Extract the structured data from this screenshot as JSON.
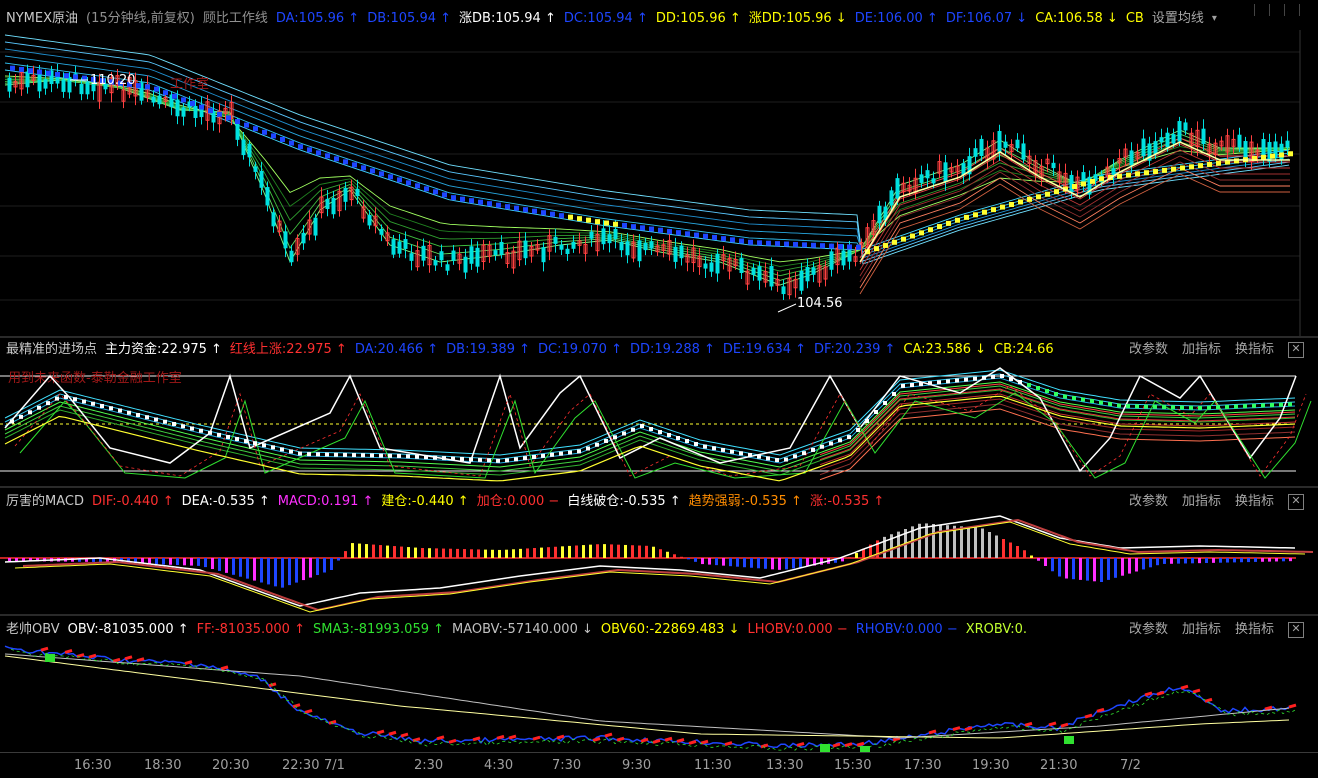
{
  "colors": {
    "red": "#ff3030",
    "white": "#ffffff",
    "yellow": "#ffff00",
    "blue": "#1e3cff",
    "cyan": "#00e5ff",
    "green": "#30e030",
    "magenta": "#ff30ff",
    "orange": "#ff8c00",
    "gray": "#c0c0c0"
  },
  "main": {
    "title": "NYMEX原油",
    "subtitle": "(15分钟线,前复权)",
    "studio": "顾比工作线",
    "indicators": [
      {
        "text": "DA:105.96 ↑",
        "color": "#1e46ff"
      },
      {
        "text": "DB:105.94 ↑",
        "color": "#1e46ff"
      },
      {
        "text": "涨DB:105.94 ↑",
        "color": "#ffffff"
      },
      {
        "text": "DC:105.94 ↑",
        "color": "#1e46ff"
      },
      {
        "text": "DD:105.96 ↑",
        "color": "#ffff00"
      },
      {
        "text": "涨DD:105.96 ↓",
        "color": "#ffff00"
      },
      {
        "text": "DE:106.00 ↑",
        "color": "#1e46ff"
      },
      {
        "text": "DF:106.07 ↓",
        "color": "#1e46ff"
      },
      {
        "text": "CA:106.58 ↓",
        "color": "#ffff00"
      },
      {
        "text": "CB",
        "color": "#ffff00"
      }
    ],
    "settings_label": "设置均线",
    "high_label": "110.20",
    "low_label": "104.56",
    "watermark": "工作室"
  },
  "entry": {
    "title": "最精准的进场点",
    "indicators": [
      {
        "text": "主力资金:22.975 ↑",
        "color": "#ffffff"
      },
      {
        "text": "红线上涨:22.975 ↑",
        "color": "#ff3030"
      },
      {
        "text": "DA:20.466 ↑",
        "color": "#1e46ff"
      },
      {
        "text": "DB:19.389 ↑",
        "color": "#1e46ff"
      },
      {
        "text": "DC:19.070 ↑",
        "color": "#1e46ff"
      },
      {
        "text": "DD:19.288 ↑",
        "color": "#1e46ff"
      },
      {
        "text": "DE:19.634 ↑",
        "color": "#1e46ff"
      },
      {
        "text": "DF:20.239 ↑",
        "color": "#1e46ff"
      },
      {
        "text": "CA:23.586 ↓",
        "color": "#ffff00"
      },
      {
        "text": "CB:24.66",
        "color": "#ffff00"
      }
    ],
    "watermark": "用到未来函数-泰勒金融工作室",
    "buttons": [
      "改参数",
      "加指标",
      "换指标"
    ]
  },
  "macd": {
    "title": "厉害的MACD",
    "indicators": [
      {
        "text": "DIF:-0.440 ↑",
        "color": "#ff3030"
      },
      {
        "text": "DEA:-0.535 ↑",
        "color": "#ffffff"
      },
      {
        "text": "MACD:0.191 ↑",
        "color": "#ff30ff"
      },
      {
        "text": "建仓:-0.440 ↑",
        "color": "#ffff00"
      },
      {
        "text": "加仓:0.000 −",
        "color": "#ff3030"
      },
      {
        "text": "白线破仓:-0.535 ↑",
        "color": "#ffffff"
      },
      {
        "text": "趋势强弱:-0.535 ↑",
        "color": "#ff8c00"
      },
      {
        "text": "涨:-0.535 ↑",
        "color": "#ff3030"
      }
    ],
    "buttons": [
      "改参数",
      "加指标",
      "换指标"
    ]
  },
  "obv": {
    "title": "老帅OBV",
    "indicators": [
      {
        "text": "OBV:-81035.000 ↑",
        "color": "#ffffff"
      },
      {
        "text": "FF:-81035.000 ↑",
        "color": "#ff3030"
      },
      {
        "text": "SMA3:-81993.059 ↑",
        "color": "#30e030"
      },
      {
        "text": "MAOBV:-57140.000 ↓",
        "color": "#c0c0c0"
      },
      {
        "text": "OBV60:-22869.483 ↓",
        "color": "#ffff00"
      },
      {
        "text": "LHOBV:0.000 −",
        "color": "#ff3030"
      },
      {
        "text": "RHOBV:0.000 −",
        "color": "#1e46ff"
      },
      {
        "text": "XROBV:0.",
        "color": "#c0ff30"
      }
    ],
    "buttons": [
      "改参数",
      "加指标",
      "换指标"
    ]
  },
  "time_axis": [
    "16:30",
    "18:30",
    "20:30",
    "22:30",
    "7/1",
    "2:30",
    "4:30",
    "7:30",
    "9:30",
    "11:30",
    "13:30",
    "15:30",
    "17:30",
    "19:30",
    "21:30",
    "7/2"
  ],
  "chart_data": [
    {
      "type": "line",
      "title": "NYMEX原油",
      "note": "15-minute candlestick price chart with Guppy MA ribbons; marked high 110.20, marked low 104.56",
      "series": [
        {
          "name": "DA",
          "last": 105.96
        },
        {
          "name": "DB",
          "last": 105.94
        },
        {
          "name": "DC",
          "last": 105.94
        },
        {
          "name": "DD",
          "last": 105.96
        },
        {
          "name": "DE",
          "last": 106.0
        },
        {
          "name": "DF",
          "last": 106.07
        },
        {
          "name": "CA",
          "last": 106.58
        }
      ]
    },
    {
      "type": "line",
      "title": "最精准的进场点",
      "series": [
        {
          "name": "主力资金",
          "last": 22.975
        },
        {
          "name": "DA",
          "last": 20.466
        },
        {
          "name": "DB",
          "last": 19.389
        },
        {
          "name": "DC",
          "last": 19.07
        },
        {
          "name": "DD",
          "last": 19.288
        },
        {
          "name": "DE",
          "last": 19.634
        },
        {
          "name": "DF",
          "last": 20.239
        },
        {
          "name": "CA",
          "last": 23.586
        },
        {
          "name": "CB",
          "last": 24.66
        }
      ]
    },
    {
      "type": "bar",
      "title": "厉害的MACD",
      "series": [
        {
          "name": "DIF",
          "last": -0.44
        },
        {
          "name": "DEA",
          "last": -0.535
        },
        {
          "name": "MACD",
          "last": 0.191
        }
      ]
    },
    {
      "type": "line",
      "title": "老帅OBV",
      "series": [
        {
          "name": "OBV",
          "last": -81035.0
        },
        {
          "name": "FF",
          "last": -81035.0
        },
        {
          "name": "SMA3",
          "last": -81993.059
        },
        {
          "name": "MAOBV",
          "last": -57140.0
        },
        {
          "name": "OBV60",
          "last": -22869.483
        }
      ]
    }
  ]
}
